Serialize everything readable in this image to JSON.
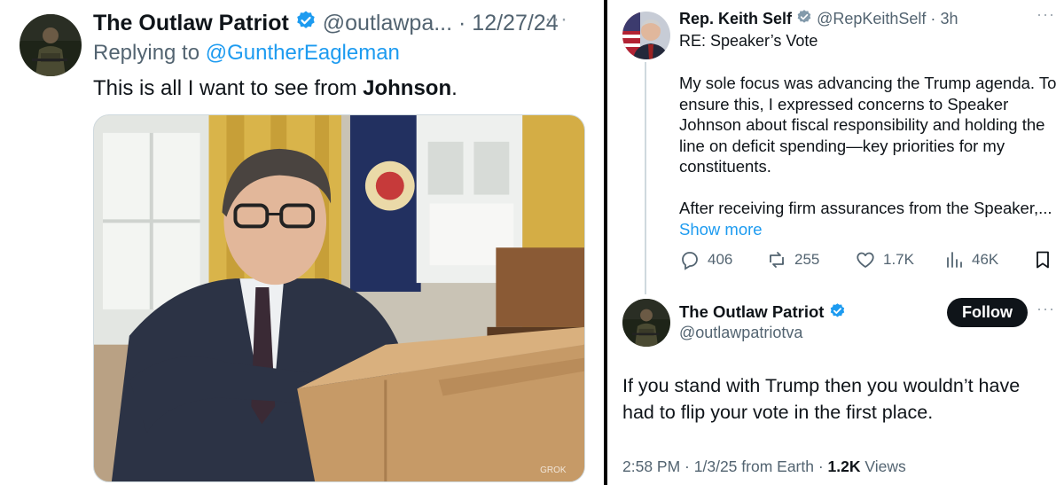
{
  "left_tweet": {
    "display_name": "The Outlaw Patriot",
    "handle": "@outlawpa...",
    "separator": "·",
    "date": "12/27/24",
    "replying_to_label": "Replying to",
    "replying_to_handle": "@GuntherEagleman",
    "text_before": "This is all I want to see from ",
    "text_bold": "Johnson",
    "text_after": ".",
    "image_watermark": "GROK",
    "more_icon": "more-horizontal-icon"
  },
  "right_quoted_tweet": {
    "display_name": "Rep. Keith Self",
    "handle": "@RepKeithSelf",
    "separator": "·",
    "time_ago": "3h",
    "subject": "RE: Speaker’s Vote",
    "paragraph_1": "My sole focus was advancing the Trump agenda. To ensure this, I expressed concerns to Speaker Johnson about fiscal responsibility and holding the line on deficit spending—key priorities for my constituents.",
    "paragraph_2": "After receiving firm assurances from the Speaker,...",
    "show_more": "Show more",
    "stats": {
      "replies": "406",
      "reposts": "255",
      "likes": "1.7K",
      "views": "46K"
    },
    "verified_badge_color": "#829aab"
  },
  "right_reply": {
    "display_name": "The Outlaw Patriot",
    "handle": "@outlawpatriotva",
    "follow_label": "Follow",
    "text": "If you stand with Trump then you wouldn’t have had to flip your vote in the first place.",
    "time": "2:58 PM",
    "date": "1/3/25",
    "source": "from Earth",
    "views_count": "1.2K",
    "views_label": "Views",
    "verified_badge_color": "#1d9bf0"
  },
  "colors": {
    "accent": "#1d9bf0",
    "text_primary": "#0f1419",
    "text_secondary": "#536471",
    "divider": "#000000"
  }
}
